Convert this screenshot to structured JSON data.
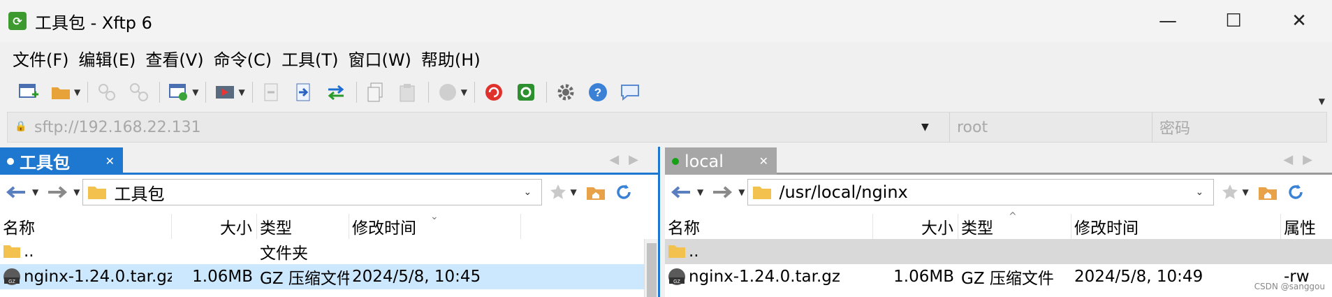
{
  "window": {
    "title": "工具包 - Xftp 6",
    "controls": {
      "minimize": "—",
      "maximize": "☐",
      "close": "✕"
    }
  },
  "menu": [
    "文件(F)",
    "编辑(E)",
    "查看(V)",
    "命令(C)",
    "工具(T)",
    "窗口(W)",
    "帮助(H)"
  ],
  "address": {
    "host": "sftp://192.168.22.131",
    "user_placeholder": "root",
    "password_placeholder": "密码"
  },
  "left_panel": {
    "tab_label": "工具包",
    "path": "工具包",
    "columns": {
      "name": "名称",
      "size": "大小",
      "type": "类型",
      "modified": "修改时间"
    },
    "rows": [
      {
        "name": "..",
        "size": "",
        "type": "文件夹",
        "modified": "",
        "icon": "folder-icon"
      },
      {
        "name": "nginx-1.24.0.tar.gz",
        "size": "1.06MB",
        "type": "GZ 压缩文件",
        "modified": "2024/5/8, 10:45",
        "icon": "gz-file-icon"
      }
    ]
  },
  "right_panel": {
    "tab_label": "local",
    "path": "/usr/local/nginx",
    "columns": {
      "name": "名称",
      "size": "大小",
      "type": "类型",
      "modified": "修改时间",
      "attrs": "属性"
    },
    "rows": [
      {
        "name": "..",
        "size": "",
        "type": "",
        "modified": "",
        "attrs": "",
        "icon": "folder-icon"
      },
      {
        "name": "nginx-1.24.0.tar.gz",
        "size": "1.06MB",
        "type": "GZ 压缩文件",
        "modified": "2024/5/8, 10:49",
        "attrs": "-rw",
        "icon": "gz-file-icon"
      }
    ]
  },
  "watermark": "CSDN @sanggou",
  "colors": {
    "accent": "#1e78d0",
    "selected_row": "#cce8ff",
    "inactive_tab": "#a6a6a6",
    "status_green": "#16a016"
  }
}
